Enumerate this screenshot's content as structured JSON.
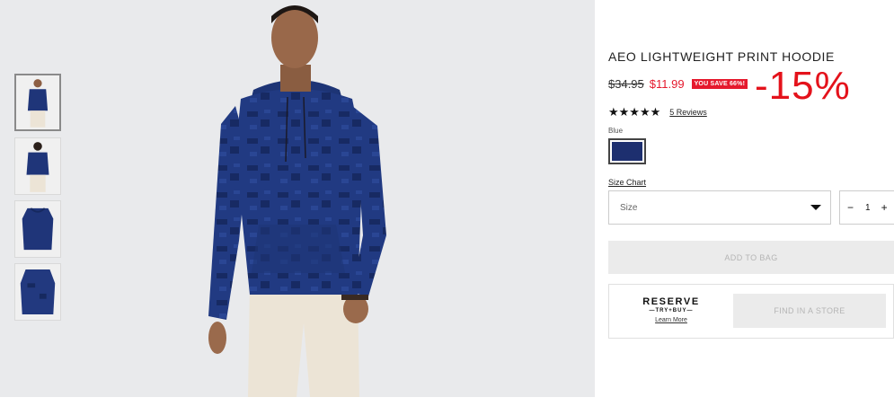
{
  "product": {
    "title": "AEO LIGHTWEIGHT PRINT HOODIE",
    "old_price": "$34.95",
    "new_price": "$11.99",
    "save_badge": "YOU SAVE 66%!",
    "discount_overlay": "-15%",
    "rating": {
      "stars": "★★★★★",
      "value": 5,
      "max": 5,
      "reviews_label": "5 Reviews"
    },
    "color": {
      "label": "Blue",
      "swatch_color": "#1d2f6f"
    },
    "size_chart_label": "Size Chart",
    "size_select": {
      "selected": "Size"
    },
    "quantity": {
      "minus": "−",
      "value": "1",
      "plus": "+"
    },
    "add_to_bag_label": "ADD TO BAG",
    "reserve": {
      "line1": "RESERVE",
      "line2": "—TRY+BUY—",
      "learn_more": "Learn More"
    },
    "find_in_store_label": "FIND IN A STORE"
  },
  "gallery": {
    "thumbnails": [
      {
        "name": "front view",
        "active": true
      },
      {
        "name": "back view",
        "active": false
      },
      {
        "name": "flat lay",
        "active": false
      },
      {
        "name": "detail",
        "active": false
      }
    ]
  },
  "colors": {
    "accent_red": "#e5192d",
    "hoodie_blue": "#1d2f6f",
    "background_gray": "#e9eaec"
  }
}
